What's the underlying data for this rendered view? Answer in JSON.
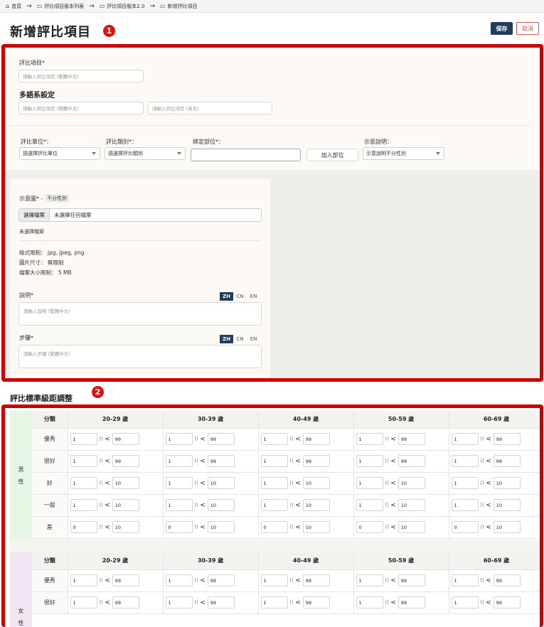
{
  "breadcrumb": [
    "首頁",
    "評比項目版本列表",
    "評比項目版本2.0",
    "新增評比項目"
  ],
  "page_title": "新增評比項目",
  "badges": [
    "1",
    "2"
  ],
  "actions": {
    "save": "保存",
    "cancel": "取消"
  },
  "form": {
    "item_label": "評比項目*",
    "item_placeholder": "請輸入評比項目 (繁體中文)",
    "multilang_heading": "多語系設定",
    "item_placeholder_sc": "請輸入評比項目 (簡體中文)",
    "item_placeholder_en": "請輸入評比項目 (英文)",
    "unit_label": "評比單位*：",
    "unit_value": "請選擇評比單位",
    "category_label": "評比類別*：",
    "category_value": "請選擇評比類別",
    "bind_label": "綁定部位*：",
    "add_part_button": "加入部位",
    "demo_label": "示意說明：",
    "demo_value": "示意說明不分性別",
    "image_label": "示意圖* -",
    "image_tag": "不分性別",
    "choose_file": "選擇檔案",
    "no_file_selected": "未選擇任何檔案",
    "no_file": "未選擇檔案",
    "format_limit": "格式限制： jpg, jpeg, png",
    "size_limit": "圖片尺寸： 無限制",
    "file_size_limit": "檔案大小限制： 5 MB",
    "desc_label": "說明*",
    "desc_placeholder": "請輸入說明 (繁體中文)",
    "steps_label": "步驟*",
    "steps_placeholder": "請輸入步驟 (繁體中文)",
    "langs": [
      "ZH",
      "CN",
      "EN"
    ]
  },
  "grading": {
    "heading": "評比標準級距調整",
    "category_header": "分類",
    "age_groups": [
      "20-29 歲",
      "30-39 歲",
      "40-49 歲",
      "50-59 歲",
      "60-69 歲"
    ],
    "male_label": [
      "男",
      "性"
    ],
    "female_label": [
      "女",
      "性"
    ],
    "levels": [
      "優秀",
      "很好",
      "好",
      "一般",
      "差"
    ],
    "male_rows": [
      {
        "min": "1",
        "max": "99"
      },
      {
        "min": "1",
        "max": "99"
      },
      {
        "min": "1",
        "max": "10"
      },
      {
        "min": "1",
        "max": "10"
      },
      {
        "min": "0",
        "max": "10"
      }
    ],
    "female_rows": [
      {
        "min": "1",
        "max": "99"
      },
      {
        "min": "1",
        "max": "99"
      }
    ],
    "ge_symbol": "⌈⌉",
    "lt_symbol": "<"
  },
  "colors": {
    "primary": "#1f3d5c",
    "danger": "#d9534f",
    "highlight": "#c80000",
    "male_bg": "#e5f6e5",
    "female_bg": "#f3e6f3"
  }
}
